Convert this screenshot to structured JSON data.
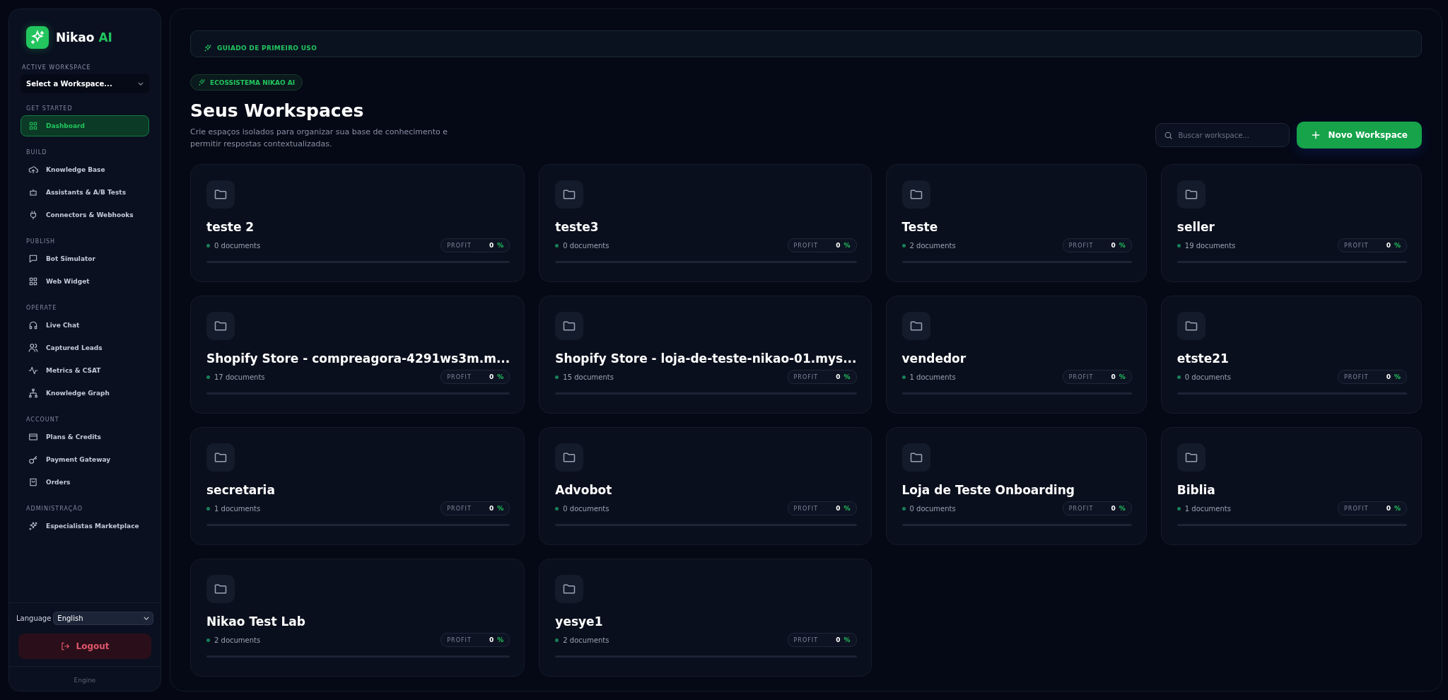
{
  "brand": {
    "name": "Nikao",
    "accent": "AI"
  },
  "sidebar": {
    "workspace_label": "ACTIVE WORKSPACE",
    "workspace_select": "Select a Workspace...",
    "sections": [
      {
        "title": "GET STARTED",
        "items": [
          {
            "label": "Dashboard",
            "selected": true
          }
        ]
      },
      {
        "title": "BUILD",
        "items": [
          {
            "label": "Knowledge Base",
            "selected": false
          },
          {
            "label": "Assistants & A/B Tests",
            "selected": false
          },
          {
            "label": "Connectors & Webhooks",
            "selected": false
          }
        ]
      },
      {
        "title": "PUBLISH",
        "items": [
          {
            "label": "Bot Simulator",
            "selected": false
          },
          {
            "label": "Web Widget",
            "selected": false
          }
        ]
      },
      {
        "title": "OPERATE",
        "items": [
          {
            "label": "Live Chat",
            "selected": false
          },
          {
            "label": "Captured Leads",
            "selected": false
          },
          {
            "label": "Metrics & CSAT",
            "selected": false
          },
          {
            "label": "Knowledge Graph",
            "selected": false
          }
        ]
      },
      {
        "title": "ACCOUNT",
        "items": [
          {
            "label": "Plans & Credits",
            "selected": false
          },
          {
            "label": "Payment Gateway",
            "selected": false
          },
          {
            "label": "Orders",
            "selected": false
          }
        ]
      },
      {
        "title": "ADMINISTRAÇÃO",
        "items": [
          {
            "label": "Especialistas Marketplace",
            "selected": false
          }
        ]
      }
    ],
    "language_label": "Language",
    "language_value": "English",
    "logout": "Logout",
    "footer": "Engine"
  },
  "guide_banner": "GUIADO DE PRIMEIRO USO",
  "badge": "ECOSSISTEMA NIKAO AI",
  "title": "Seus Workspaces",
  "subtitle": "Crie espaços isolados para organizar sua base de conhecimento e permitir respostas contextualizadas.",
  "search": {
    "placeholder": "Buscar workspace..."
  },
  "new_button": "Novo Workspace",
  "workspaces": [
    {
      "name": "teste 2",
      "documents": "0 documents",
      "profit_label": "PROFIT",
      "profit_value": "0",
      "profit_unit": "%",
      "level": 0
    },
    {
      "name": "teste3",
      "documents": "0 documents",
      "profit_label": "PROFIT",
      "profit_value": "0",
      "profit_unit": "%",
      "level": 0
    },
    {
      "name": "Teste",
      "documents": "2 documents",
      "profit_label": "PROFIT",
      "profit_value": "0",
      "profit_unit": "%",
      "level": 0
    },
    {
      "name": "seller",
      "documents": "19 documents",
      "profit_label": "PROFIT",
      "profit_value": "0",
      "profit_unit": "%",
      "level": 0
    },
    {
      "name": "Shopify Store - compreagora-4291ws3m.m...",
      "documents": "17 documents",
      "profit_label": "PROFIT",
      "profit_value": "0",
      "profit_unit": "%",
      "level": 0
    },
    {
      "name": "Shopify Store - loja-de-teste-nikao-01.mys...",
      "documents": "15 documents",
      "profit_label": "PROFIT",
      "profit_value": "0",
      "profit_unit": "%",
      "level": 0
    },
    {
      "name": "vendedor",
      "documents": "1 documents",
      "profit_label": "PROFIT",
      "profit_value": "0",
      "profit_unit": "%",
      "level": 0
    },
    {
      "name": "etste21",
      "documents": "0 documents",
      "profit_label": "PROFIT",
      "profit_value": "0",
      "profit_unit": "%",
      "level": 0
    },
    {
      "name": "secretaria",
      "documents": "1 documents",
      "profit_label": "PROFIT",
      "profit_value": "0",
      "profit_unit": "%",
      "level": 0
    },
    {
      "name": "Advobot",
      "documents": "0 documents",
      "profit_label": "PROFIT",
      "profit_value": "0",
      "profit_unit": "%",
      "level": 0
    },
    {
      "name": "Loja de Teste Onboarding",
      "documents": "0 documents",
      "profit_label": "PROFIT",
      "profit_value": "0",
      "profit_unit": "%",
      "level": 0
    },
    {
      "name": "Biblia",
      "documents": "1 documents",
      "profit_label": "PROFIT",
      "profit_value": "0",
      "profit_unit": "%",
      "level": 0
    },
    {
      "name": "Nikao Test Lab",
      "documents": "2 documents",
      "profit_label": "PROFIT",
      "profit_value": "0",
      "profit_unit": "%",
      "level": 0
    },
    {
      "name": "yesye1",
      "documents": "2 documents",
      "profit_label": "PROFIT",
      "profit_value": "0",
      "profit_unit": "%",
      "level": 0
    }
  ]
}
